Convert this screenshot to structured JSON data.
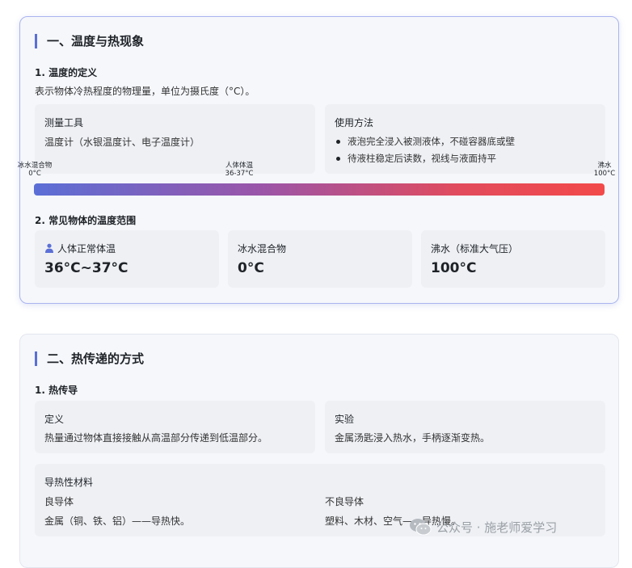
{
  "section1": {
    "title": "一、温度与热现象",
    "sub1": "1. 温度的定义",
    "definition": "表示物体冷热程度的物理量，单位为摄氏度（°C）。",
    "tools_box": {
      "label": "测量工具",
      "body": "温度计（水银温度计、电子温度计）"
    },
    "usage_box": {
      "label": "使用方法",
      "items": [
        "液泡完全浸入被测液体，不碰容器底或壁",
        "待液柱稳定后读数，视线与液面持平"
      ]
    },
    "scale": {
      "markers": [
        {
          "name": "冰水混合物",
          "value": "0°C"
        },
        {
          "name": "人体体温",
          "value": "36-37°C"
        },
        {
          "name": "沸水",
          "value": "100°C"
        }
      ],
      "gradient_colors": [
        "#5b6fd6",
        "#9b55a8",
        "#e24b5c",
        "#f24a4a"
      ]
    },
    "sub2": "2. 常见物体的温度范围",
    "ranges": [
      {
        "label": "人体正常体温",
        "value": "36°C~37°C",
        "icon": "person-icon"
      },
      {
        "label": "冰水混合物",
        "value": "0°C"
      },
      {
        "label": "沸水（标准大气压）",
        "value": "100°C"
      }
    ]
  },
  "section2": {
    "title": "二、热传递的方式",
    "sub1": "1. 热传导",
    "definition_box": {
      "label": "定义",
      "body": "热量通过物体直接接触从高温部分传递到低温部分。"
    },
    "experiment_box": {
      "label": "实验",
      "body": "金属汤匙浸入热水，手柄逐渐变热。"
    },
    "materials_box": {
      "label": "导热性材料",
      "good_title": "良导体",
      "good_body": "金属（铜、铁、铝）——导热快。",
      "bad_title": "不良导体",
      "bad_body": "塑料、木材、空气——导热慢。"
    }
  },
  "watermark": {
    "text": "公众号 · 施老师爱学习",
    "icon": "wechat-icon"
  },
  "colors": {
    "accent": "#5b6fd6",
    "card_bg": "#f5f7fb",
    "box_bg": "#eef0f4"
  }
}
